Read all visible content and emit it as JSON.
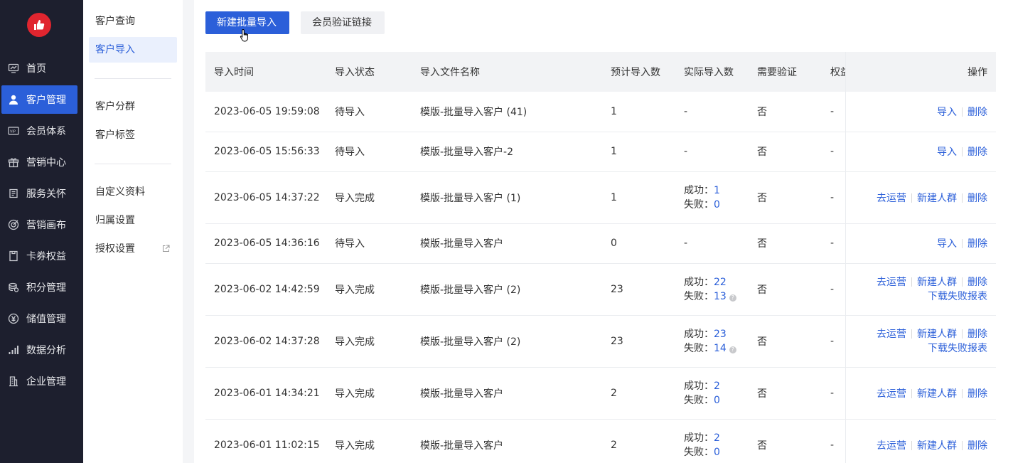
{
  "nav": {
    "items": [
      {
        "label": "首页",
        "icon": "dashboard-icon"
      },
      {
        "label": "客户管理",
        "icon": "user-icon",
        "active": true
      },
      {
        "label": "会员体系",
        "icon": "vip-card-icon"
      },
      {
        "label": "营销中心",
        "icon": "gift-icon"
      },
      {
        "label": "服务关怀",
        "icon": "service-icon"
      },
      {
        "label": "营销画布",
        "icon": "target-icon"
      },
      {
        "label": "卡券权益",
        "icon": "coupon-icon"
      },
      {
        "label": "积分管理",
        "icon": "coins-icon"
      },
      {
        "label": "储值管理",
        "icon": "yen-icon"
      },
      {
        "label": "数据分析",
        "icon": "bar-chart-icon"
      },
      {
        "label": "企业管理",
        "icon": "building-icon"
      }
    ],
    "accent": "#2b5fd9",
    "background": "#1d1f2e"
  },
  "submenu": {
    "group1": [
      "客户查询",
      "客户导入"
    ],
    "group2": [
      "客户分群",
      "客户标签"
    ],
    "group3": [
      "自定义资料",
      "归属设置",
      "授权设置"
    ]
  },
  "toolbar": {
    "new_import": "新建批量导入",
    "member_link": "会员验证链接"
  },
  "table": {
    "headers": [
      "导入时间",
      "导入状态",
      "导入文件名称",
      "预计导入数",
      "实际导入数",
      "需要验证",
      "权益-",
      "操作"
    ],
    "success_label": "成功：",
    "fail_label": "失败：",
    "op_import": "导入",
    "op_delete": "删除",
    "op_operate": "去运营",
    "op_new_group": "新建人群",
    "op_download_fail": "下载失败报表",
    "rows": [
      {
        "time": "2023-06-05 19:59:08",
        "status": "待导入",
        "file": "模版-批量导入客户 (41)",
        "expected": "1",
        "actual": "-",
        "verify": "否",
        "rights": "-"
      },
      {
        "time": "2023-06-05 15:56:33",
        "status": "待导入",
        "file": "模版-批量导入客户-2",
        "expected": "1",
        "actual": "-",
        "verify": "否",
        "rights": "-"
      },
      {
        "time": "2023-06-05 14:37:22",
        "status": "导入完成",
        "file": "模版-批量导入客户 (1)",
        "expected": "1",
        "success": "1",
        "fail": "0",
        "verify": "否",
        "rights": "-"
      },
      {
        "time": "2023-06-05 14:36:16",
        "status": "待导入",
        "file": "模版-批量导入客户",
        "expected": "0",
        "actual": "-",
        "verify": "否",
        "rights": "-"
      },
      {
        "time": "2023-06-02 14:42:59",
        "status": "导入完成",
        "file": "模版-批量导入客户 (2)",
        "expected": "23",
        "success": "22",
        "fail": "13",
        "verify": "否",
        "rights": "-"
      },
      {
        "time": "2023-06-02 14:37:28",
        "status": "导入完成",
        "file": "模版-批量导入客户 (2)",
        "expected": "23",
        "success": "23",
        "fail": "14",
        "verify": "否",
        "rights": "-"
      },
      {
        "time": "2023-06-01 14:34:21",
        "status": "导入完成",
        "file": "模版-批量导入客户",
        "expected": "2",
        "success": "2",
        "fail": "0",
        "verify": "否",
        "rights": "-"
      },
      {
        "time": "2023-06-01 11:02:15",
        "status": "导入完成",
        "file": "模版-批量导入客户",
        "expected": "2",
        "success": "2",
        "fail": "0",
        "verify": "否",
        "rights": "-"
      }
    ]
  }
}
